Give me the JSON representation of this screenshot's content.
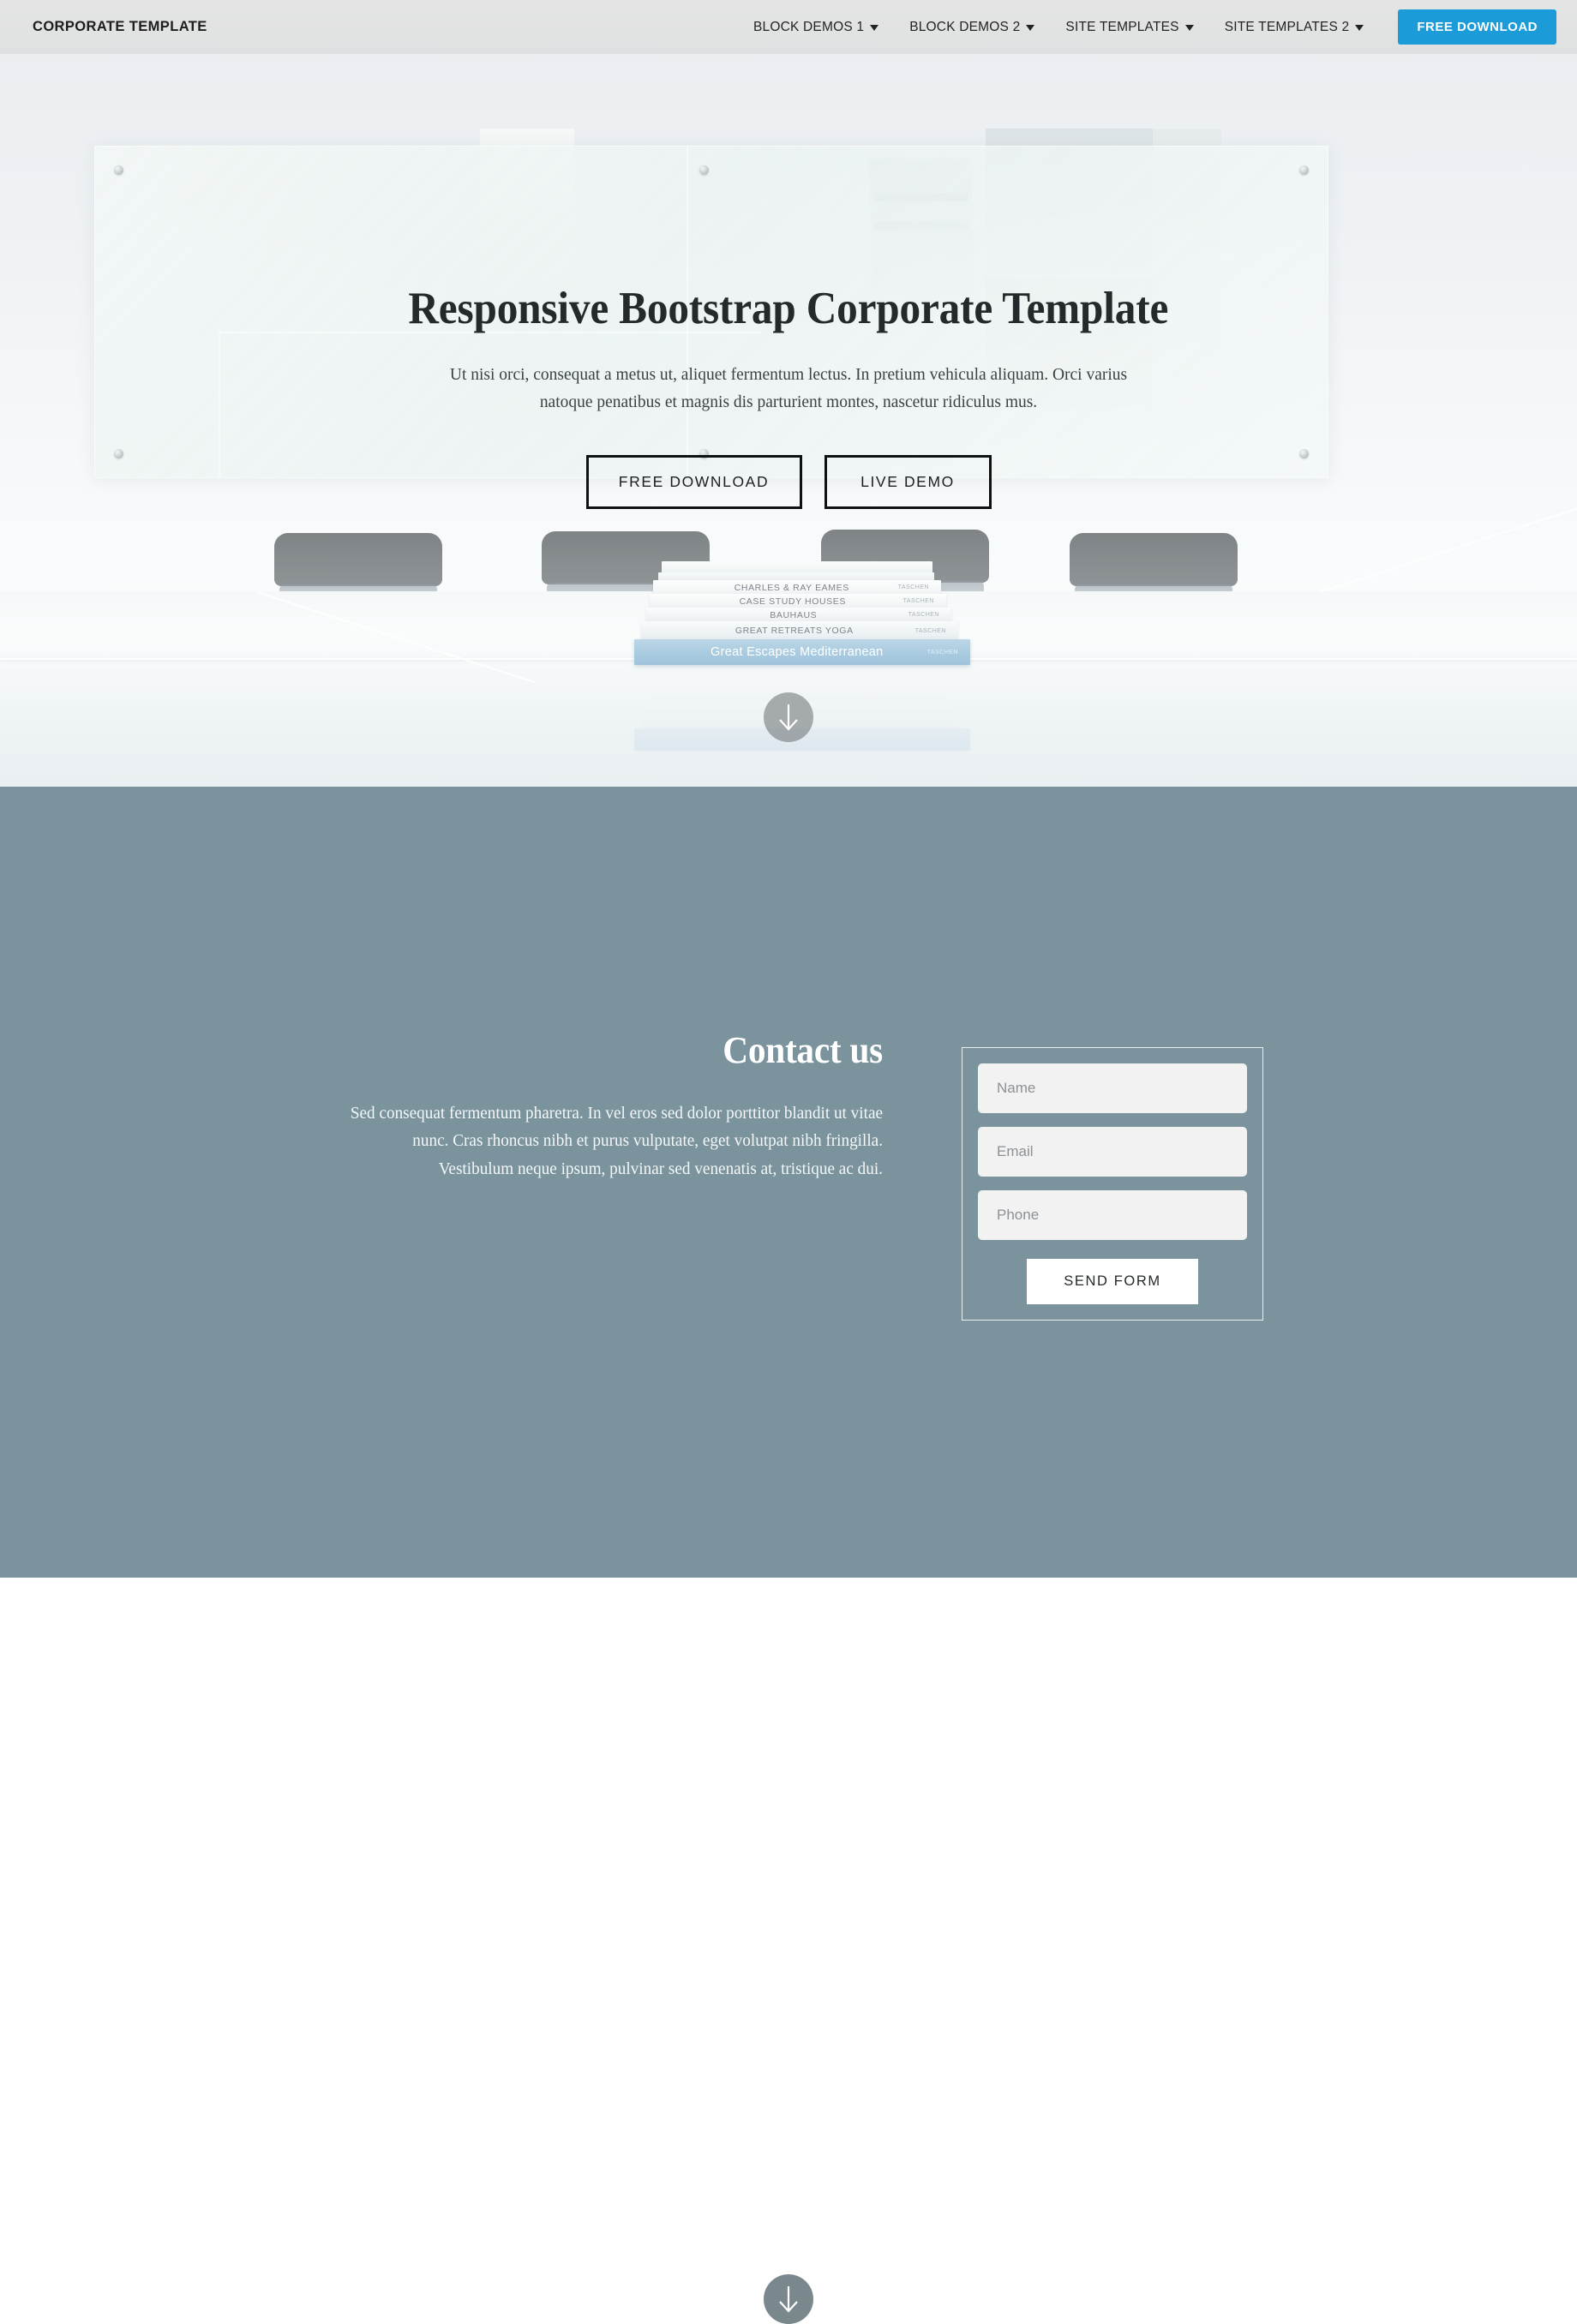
{
  "navbar": {
    "brand": "CORPORATE TEMPLATE",
    "items": [
      {
        "label": "BLOCK DEMOS 1",
        "caret": "chevron-down-icon"
      },
      {
        "label": "BLOCK DEMOS 2",
        "caret": "chevron-down-icon"
      },
      {
        "label": "SITE TEMPLATES",
        "caret": "chevron-down-icon"
      },
      {
        "label": "SITE TEMPLATES 2",
        "caret": "chevron-down-icon"
      }
    ],
    "cta_label": "FREE DOWNLOAD",
    "cta_color": "#1b9cd8",
    "background": "#e2e2e2"
  },
  "hero": {
    "title": "Responsive Bootstrap Corporate Template",
    "subtitle": "Ut nisi orci, consequat a metus ut, aliquet fermentum lectus. In pretium vehicula aliquam. Orci varius natoque penatibus et magnis dis parturient montes, nascetur ridiculus mus.",
    "primary_button": "FREE DOWNLOAD",
    "secondary_button": "LIVE DEMO",
    "scroll_icon": "arrow-down-icon",
    "background_scene": "bright conference room with glass whiteboard, grey chairs and stacked books on a glossy white table",
    "books": [
      {
        "title": "CHARLES & RAY EAMES",
        "publisher": "TASCHEN",
        "author": ""
      },
      {
        "title": "CASE STUDY HOUSES",
        "publisher": "TASCHEN",
        "author": ""
      },
      {
        "title": "BAUHAUS",
        "publisher": "TASCHEN",
        "author": ""
      },
      {
        "title": "GREAT RETREATS   YOGA",
        "publisher": "TASCHEN",
        "author": ""
      },
      {
        "title": "Great Escapes Mediterranean",
        "publisher": "TASCHEN",
        "author": ""
      }
    ]
  },
  "contact": {
    "title": "Contact us",
    "text": "Sed consequat fermentum pharetra. In vel eros sed dolor porttitor blandit ut vitae nunc. Cras rhoncus nibh et purus vulputate, eget volutpat nibh fringilla. Vestibulum neque ipsum, pulvinar sed venenatis at, tristique ac dui.",
    "background": "#7a939d",
    "form": {
      "name_placeholder": "Name",
      "email_placeholder": "Email",
      "phone_placeholder": "Phone",
      "name_value": "",
      "email_value": "",
      "phone_value": "",
      "submit_label": "SEND FORM"
    },
    "scroll_icon": "arrow-down-icon"
  }
}
